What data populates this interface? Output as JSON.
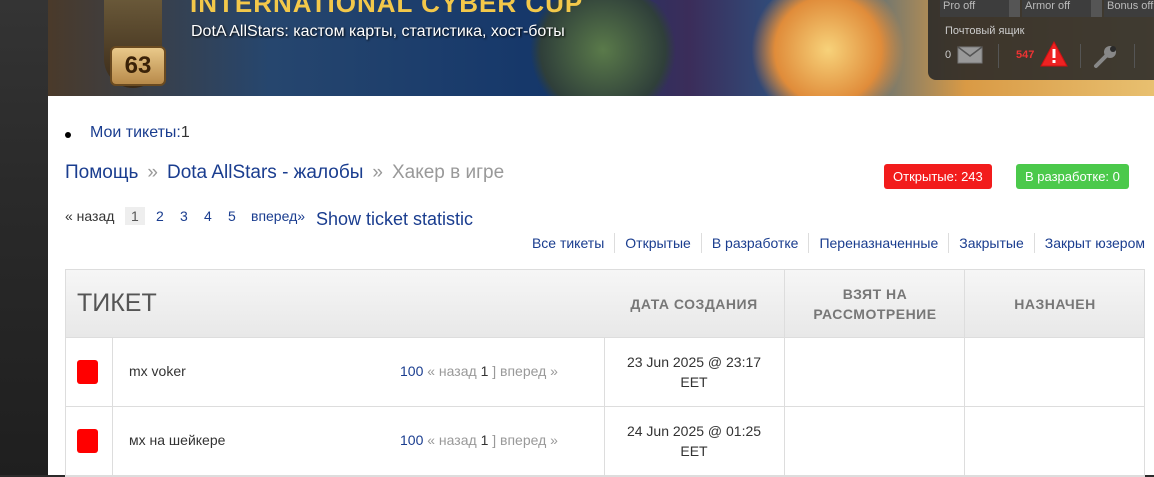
{
  "header": {
    "banner_title": "INTERNATIONAL CYBER CUP",
    "banner_subtitle": "DotA AllStars: кастом карты, статистика, хост-боты",
    "level": "63",
    "toggles": [
      "Pro off",
      "Armor off",
      "Bonus off"
    ],
    "mailbox_label": "Почтовый ящик",
    "mail_count": "0",
    "alert_count": "547"
  },
  "nav": {
    "my_tickets_label": "Мои тикеты:",
    "my_tickets_count": "1"
  },
  "breadcrumb": {
    "items": [
      "Помощь",
      "Dota AllStars - жалобы"
    ],
    "separator": "»",
    "current": "Хакер в игре"
  },
  "badges": {
    "open": "Открытые: 243",
    "in_dev": "В разработке: 0",
    "open_color": "#f21c1c",
    "dev_color": "#4bc94b"
  },
  "pagination": {
    "prev": "« назад",
    "pages": [
      "1",
      "2",
      "3",
      "4",
      "5"
    ],
    "current": "1",
    "next": "вперед»",
    "stat_link": "Show ticket statistic"
  },
  "filters": [
    "Все тикеты",
    "Открытые",
    "В разработке",
    "Переназначенные",
    "Закрытые",
    "Закрыт юзером"
  ],
  "table": {
    "columns": {
      "ticket": "ТИКЕТ",
      "created": "ДАТА СОЗДАНИЯ",
      "taken_line1": "ВЗЯТ НА",
      "taken_line2": "РАССМОТРЕНИЕ",
      "assigned": "НАЗНАЧЕН"
    },
    "rows": [
      {
        "title": "mx voker",
        "count": "100",
        "prev": "« назад",
        "page": "1",
        "bracket": "]",
        "next": "вперед »",
        "date_line1": "23 Jun 2025 @ 23:17",
        "date_line2": "EET",
        "taken": "",
        "assigned": ""
      },
      {
        "title": "мх на шейкере",
        "count": "100",
        "prev": "« назад",
        "page": "1",
        "bracket": "]",
        "next": "вперед »",
        "date_line1": "24 Jun 2025 @ 01:25",
        "date_line2": "EET",
        "taken": "",
        "assigned": ""
      }
    ]
  }
}
